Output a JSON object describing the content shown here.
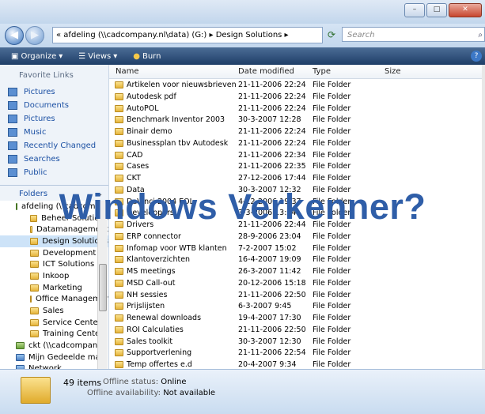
{
  "window": {
    "min": "–",
    "max": "□",
    "close": "✕"
  },
  "address": {
    "back": "◀",
    "forward": "▶",
    "path": "« afdeling (\\\\cadcompany.nl\\data) (G:) ▸ Design Solutions ▸",
    "search_placeholder": "Search",
    "search_icon": "search-icon"
  },
  "toolbar": {
    "organize": "Organize",
    "views": "Views",
    "burn": "Burn",
    "help": "?"
  },
  "sidebar": {
    "favorites_title": "Favorite Links",
    "favorites": [
      "Pictures",
      "Documents",
      "Pictures",
      "Music",
      "Recently Changed",
      "Searches",
      "Public"
    ],
    "folders_title": "Folders",
    "tree": [
      {
        "label": "afdeling (\\\\cadcompany",
        "type": "drive"
      },
      {
        "label": "Beheer Solutions",
        "type": "folder"
      },
      {
        "label": "Datamanagement",
        "type": "folder"
      },
      {
        "label": "Design Solutions",
        "type": "folder",
        "selected": true
      },
      {
        "label": "Development",
        "type": "folder"
      },
      {
        "label": "ICT Solutions",
        "type": "folder"
      },
      {
        "label": "Inkoop",
        "type": "folder"
      },
      {
        "label": "Marketing",
        "type": "folder"
      },
      {
        "label": "Office Management",
        "type": "folder"
      },
      {
        "label": "Sales",
        "type": "folder"
      },
      {
        "label": "Service Center",
        "type": "folder"
      },
      {
        "label": "Training Center",
        "type": "folder"
      },
      {
        "label": "ckt (\\\\cadcompany",
        "type": "drive"
      },
      {
        "label": "Mijn Gedeelde ma",
        "type": "net"
      },
      {
        "label": "Network",
        "type": "net"
      }
    ]
  },
  "columns": {
    "name": "Name",
    "date": "Date modified",
    "type": "Type",
    "size": "Size"
  },
  "files": [
    {
      "name": "Artikelen voor nieuwsbrieven",
      "date": "21-11-2006 22:24",
      "type": "File Folder"
    },
    {
      "name": "Autodesk pdf",
      "date": "21-11-2006 22:24",
      "type": "File Folder"
    },
    {
      "name": "AutoPOL",
      "date": "21-11-2006 22:24",
      "type": "File Folder"
    },
    {
      "name": "Benchmark Inventor 2003",
      "date": "30-3-2007 12:28",
      "type": "File Folder"
    },
    {
      "name": "Binair demo",
      "date": "21-11-2006 22:24",
      "type": "File Folder"
    },
    {
      "name": "Businessplan tbv Autodesk",
      "date": "21-11-2006 22:24",
      "type": "File Folder"
    },
    {
      "name": "CAD",
      "date": "21-11-2006 22:34",
      "type": "File Folder"
    },
    {
      "name": "Cases",
      "date": "21-11-2006 22:35",
      "type": "File Folder"
    },
    {
      "name": "CKT",
      "date": "27-12-2006 17:44",
      "type": "File Folder"
    },
    {
      "name": "Data",
      "date": "30-3-2007 12:32",
      "type": "File Folder"
    },
    {
      "name": "DaVinci 2004 EOL",
      "date": "4-12-2006 19:37",
      "type": "File Folder"
    },
    {
      "name": "Developpers",
      "date": "3-3-2006 13:04",
      "type": "File Folder"
    },
    {
      "name": "Drivers",
      "date": "21-11-2006 22:44",
      "type": "File Folder"
    },
    {
      "name": "ERP connector",
      "date": "28-9-2006 23:04",
      "type": "File Folder"
    },
    {
      "name": "Infomap voor WTB klanten",
      "date": "7-2-2007 15:02",
      "type": "File Folder"
    },
    {
      "name": "Klantoverzichten",
      "date": "16-4-2007 19:09",
      "type": "File Folder"
    },
    {
      "name": "MS meetings",
      "date": "26-3-2007 11:42",
      "type": "File Folder"
    },
    {
      "name": "MSD Call-out",
      "date": "20-12-2006 15:18",
      "type": "File Folder"
    },
    {
      "name": "NH sessies",
      "date": "21-11-2006 22:50",
      "type": "File Folder"
    },
    {
      "name": "Prijslijsten",
      "date": "6-3-2007 9:45",
      "type": "File Folder"
    },
    {
      "name": "Renewal downloads",
      "date": "19-4-2007 17:30",
      "type": "File Folder"
    },
    {
      "name": "ROI Calculaties",
      "date": "21-11-2006 22:50",
      "type": "File Folder"
    },
    {
      "name": "Sales toolkit",
      "date": "30-3-2007 12:30",
      "type": "File Folder"
    },
    {
      "name": "Supportverlening",
      "date": "21-11-2006 22:54",
      "type": "File Folder"
    },
    {
      "name": "Temp offertes e.d",
      "date": "20-4-2007 9:34",
      "type": "File Folder"
    }
  ],
  "status": {
    "count": "49 items",
    "offline_status_label": "Offline status:",
    "offline_status_value": "Online",
    "offline_avail_label": "Offline availability:",
    "offline_avail_value": "Not available"
  },
  "overlay": "Windows Verkenner?"
}
